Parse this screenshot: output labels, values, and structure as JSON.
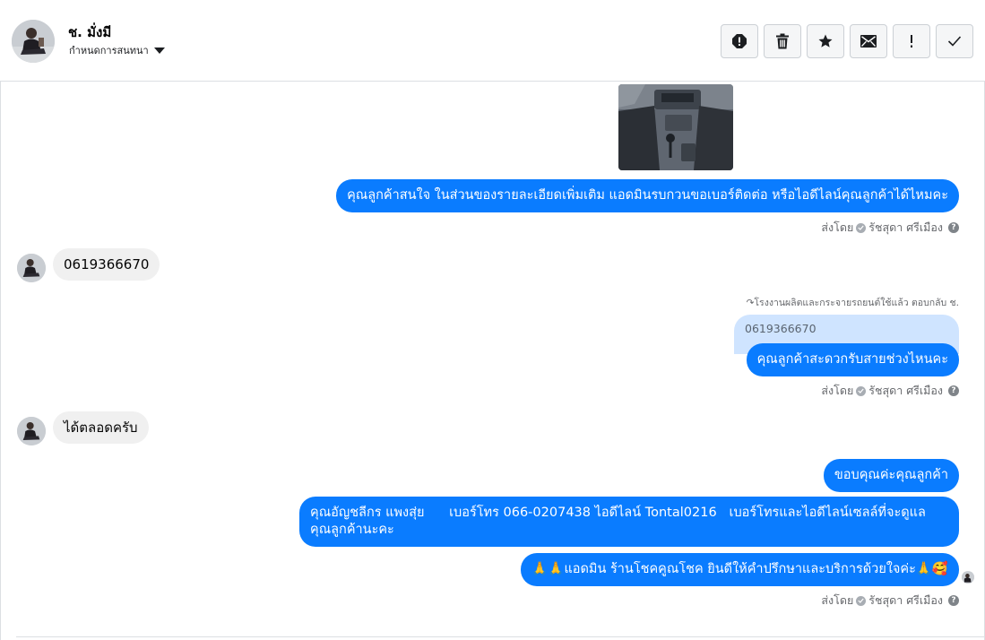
{
  "header": {
    "contact_name": "ช. มั่งมี",
    "subtitle": "กำหนดการสนทนา",
    "toolbar": [
      {
        "name": "spam-button",
        "icon": "alert-circle-icon"
      },
      {
        "name": "delete-button",
        "icon": "trash-icon"
      },
      {
        "name": "star-button",
        "icon": "star-icon"
      },
      {
        "name": "unread-button",
        "icon": "envelope-icon"
      },
      {
        "name": "important-button",
        "icon": "exclamation-icon"
      },
      {
        "name": "done-button",
        "icon": "checkmark-icon"
      }
    ]
  },
  "messages": {
    "msg1": "คุณลูกค้าสนใจ ในส่วนของรายละเอียดเพิ่มเติม แอดมินรบกวนขอเบอร์ติดต่อ หรือไอดีไลน์คุณลูกค้าได้ไหมคะ",
    "reply1": "0619366670",
    "reply_note": "โรงงานผลิตและกระจายรถยนต์ใช้แล้ว ตอบกลับ ช.",
    "quoted": "0619366670",
    "msg2": "คุณลูกค้าสะดวกรับสายช่วงไหนคะ",
    "reply2": "ได้ตลอดครับ",
    "msg3": "ขอบคุณค่ะคุณลูกค้า",
    "msg4_line1": "คุณอัญชลีกร แพงสุ่ย      เบอร์โทร 066-0207438 ไอดีไลน์ Tontal0216   เบอร์โทรและไอดีไลน์เซลล์ที่จะดูแล",
    "msg4_line2": "คุณลูกค้านะคะ",
    "msg5": "🙏🙏แอดมิน ร้านโชคคูณโชค ยินดีให้คำปรึกษาและบริการด้วยใจค่ะ🙏🥰"
  },
  "sent_by": {
    "prefix": "ส่งโดย",
    "agent": "รัชสุดา ศรีเมือง"
  },
  "colors": {
    "outgoing_bubble": "#0a7cff",
    "incoming_bubble": "#f0f0f0",
    "quoted_bubble": "#cfe4ff"
  }
}
